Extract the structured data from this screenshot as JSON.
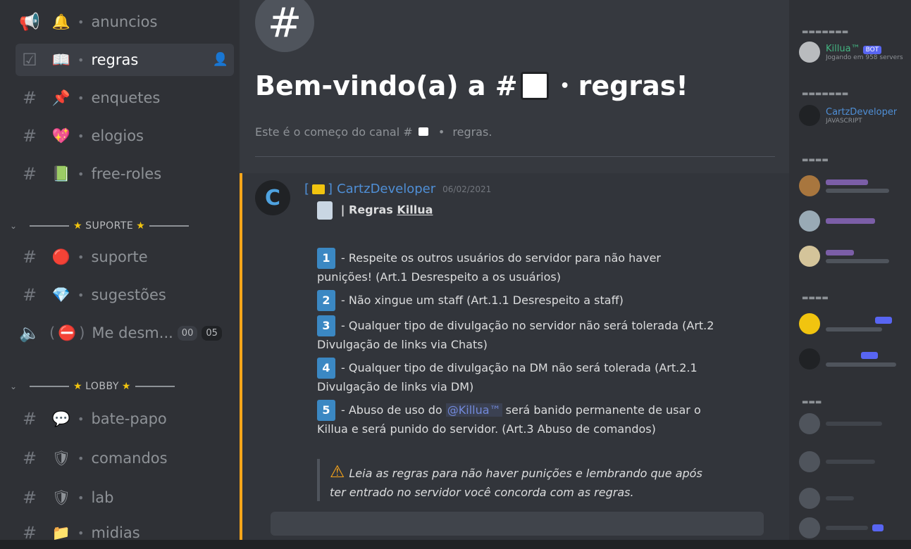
{
  "sidebar": {
    "channels": [
      {
        "lead": "📢",
        "emoji": "🔔",
        "name": "anuncios",
        "active": false
      },
      {
        "lead": "☑",
        "emoji": "📖",
        "name": "regras",
        "active": true
      },
      {
        "lead": "#",
        "emoji": "📌",
        "name": "enquetes",
        "active": false
      },
      {
        "lead": "#",
        "emoji": "💖",
        "name": "elogios",
        "active": false
      },
      {
        "lead": "#",
        "emoji": "📗",
        "name": "free-roles",
        "active": false
      }
    ],
    "category_suporte": "SUPORTE",
    "suporte_channels": [
      {
        "lead": "#",
        "emoji": "🔴",
        "name": "suporte"
      },
      {
        "lead": "#",
        "emoji": "💎",
        "name": "sugestões"
      }
    ],
    "voice_channel": {
      "name": "Me desm...",
      "count_a": "00",
      "count_b": "05"
    },
    "category_lobby": "LOBBY",
    "lobby_channels": [
      {
        "lead": "#",
        "emoji": "💬",
        "name": "bate-papo"
      },
      {
        "lead": "#",
        "emoji": "🛡",
        "name": "comandos"
      },
      {
        "lead": "#",
        "emoji": "🛡",
        "name": "lab"
      },
      {
        "lead": "#",
        "emoji": "📁",
        "name": "midias"
      }
    ]
  },
  "main": {
    "welcome_icon": "#",
    "welcome_title_prefix": "Bem-vindo(a) a #",
    "welcome_title_suffix": "regras!",
    "welcome_sub_prefix": "Este é o começo do canal #",
    "welcome_sub_suffix": "regras.",
    "message": {
      "author_prefix": "[",
      "author_suffix": "]",
      "author": "CartzDeveloper",
      "timestamp": "06/02/2021",
      "avatar_letter": "C",
      "title_prefix": "| Regras",
      "title_name": "Killua",
      "rules": [
        {
          "num": "1",
          "text": "- Respeite os outros usuários do servidor para não haver punições! (Art.1 Desrespeito a os usuários)"
        },
        {
          "num": "2",
          "text": "- Não xingue um staff (Art.1.1 Desrespeito a staff)"
        },
        {
          "num": "3",
          "text": "- Qualquer tipo de divulgação no servidor não será tolerada (Art.2 Divulgação de links via Chats)"
        },
        {
          "num": "4",
          "text": "- Qualquer tipo de divulgação na DM não será tolerada (Art.2.1 Divulgação de links via DM)"
        }
      ],
      "rule5_num": "5",
      "rule5_before": "- Abuso de uso do",
      "rule5_mention": "@Killua™",
      "rule5_after": "será banido permanente de usar o Killua e será punido do servidor. (Art.3 Abuso de comandos)",
      "warning": "Leia as regras para não haver punições e lembrando que após ter entrado no servidor você concorda com as regras."
    }
  },
  "members": {
    "member1": {
      "name": "Killua™",
      "status": "Jogando em 958 servers",
      "badge": "BOT"
    },
    "member2": {
      "name": "CartzDeveloper",
      "status": "JAVASCRIPT"
    }
  },
  "colors": {
    "sidebar_bg": "#2f3136",
    "chat_bg": "#36393f",
    "accent_gold": "#faa61a",
    "link_blue": "#4f8fd6",
    "keycap_blue": "#3b88c3"
  }
}
